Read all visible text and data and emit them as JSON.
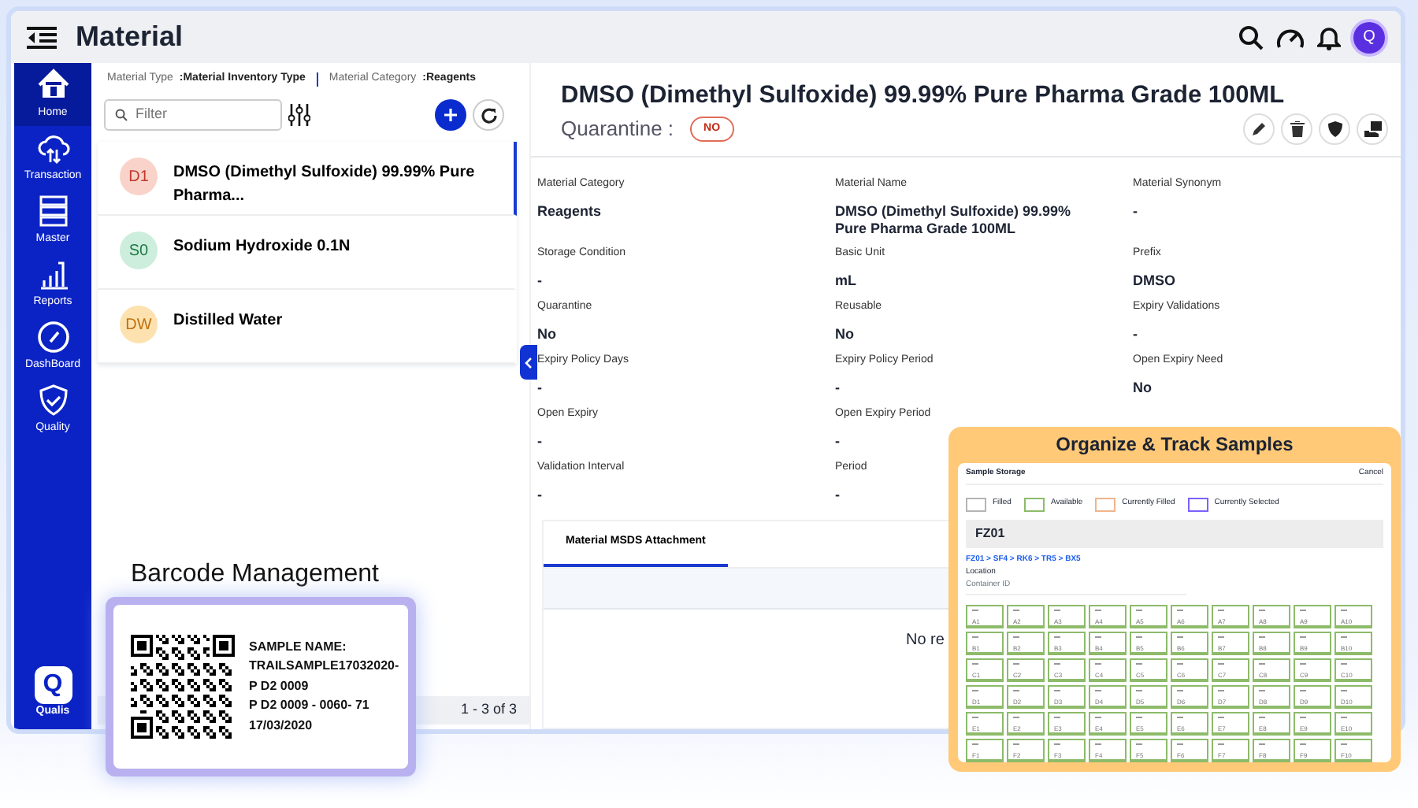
{
  "header": {
    "title": "Material",
    "avatar": "Q"
  },
  "sidebar": {
    "items": [
      {
        "label": "Home",
        "selected": true
      },
      {
        "label": "Transaction",
        "selected": false
      },
      {
        "label": "Master",
        "selected": false
      },
      {
        "label": "Reports",
        "selected": false
      },
      {
        "label": "DashBoard",
        "selected": false
      },
      {
        "label": "Quality",
        "selected": false
      }
    ],
    "logo": "Q",
    "logo_text": "Qualis"
  },
  "breadcrumb": [
    {
      "label": "Material Type",
      "value": ":Material Inventory Type"
    },
    {
      "label": "Material Category",
      "value": ":Reagents"
    }
  ],
  "filter": {
    "placeholder": "Filter"
  },
  "materials": [
    {
      "initials": "D1",
      "name": "DMSO (Dimethyl Sulfoxide) 99.99% Pure Pharma...",
      "color": "#f9d3c9",
      "selected": true
    },
    {
      "initials": "S0",
      "name": "Sodium Hydroxide 0.1N",
      "color": "#cdeedd",
      "selected": false
    },
    {
      "initials": "DW",
      "name": "Distilled Water",
      "color": "#fde2b0",
      "selected": false
    }
  ],
  "pagination": "1 - 3 of 3",
  "detail": {
    "title": "DMSO (Dimethyl Sulfoxide) 99.99% Pure Pharma Grade 100ML",
    "quarantine_label": "Quarantine :",
    "quarantine_badge": "NO",
    "fields": [
      {
        "label": "Material Category",
        "value": "Reagents"
      },
      {
        "label": "Material Name",
        "value": "DMSO (Dimethyl Sulfoxide) 99.99% Pure Pharma Grade 100ML"
      },
      {
        "label": "Material Synonym",
        "value": "-"
      },
      {
        "label": "Storage Condition",
        "value": "-"
      },
      {
        "label": "Basic Unit",
        "value": "mL"
      },
      {
        "label": "Prefix",
        "value": "DMSO"
      },
      {
        "label": "Quarantine",
        "value": "No"
      },
      {
        "label": "Reusable",
        "value": "No"
      },
      {
        "label": "Expiry Validations",
        "value": "-"
      },
      {
        "label": "Expiry Policy Days",
        "value": "-"
      },
      {
        "label": "Expiry Policy Period",
        "value": "-"
      },
      {
        "label": "Open Expiry Need",
        "value": "No"
      },
      {
        "label": "Open Expiry",
        "value": "-"
      },
      {
        "label": "Open Expiry Period",
        "value": "-"
      },
      {
        "label": "Validation Interval",
        "value": "-"
      },
      {
        "label": "Period",
        "value": "-"
      }
    ],
    "tabs": [
      {
        "label": "Material MSDS Attachment",
        "selected": true
      }
    ],
    "empty_text": "No re"
  },
  "barcode": {
    "heading": "Barcode Management",
    "lines": [
      "SAMPLE NAME:",
      "TRAILSAMPLE17032020-",
      "P D2 0009",
      "P D2 0009 - 0060- 71",
      "17/03/2020"
    ]
  },
  "storage": {
    "heading": "Organize & Track Samples",
    "title": "Sample Storage",
    "cancel": "Cancel",
    "legend": [
      {
        "label": "Filled",
        "color": "#b5b5b5"
      },
      {
        "label": "Available",
        "color": "#8dbb6a"
      },
      {
        "label": "Currently Filled",
        "color": "#f0b58c"
      },
      {
        "label": "Currently Selected",
        "color": "#7b61ff"
      }
    ],
    "freezer": "FZ01",
    "path": "FZ01 > SF4 > RK6 > TR5 > BX5",
    "location_label": "Location",
    "location_value": "Container ID",
    "rows": [
      [
        "A1",
        "A2",
        "A3",
        "A4",
        "A5",
        "A6",
        "A7",
        "A8",
        "A9",
        "A10"
      ],
      [
        "B1",
        "B2",
        "B3",
        "B4",
        "B5",
        "B6",
        "B7",
        "B8",
        "B9",
        "B10"
      ],
      [
        "C1",
        "C2",
        "C3",
        "C4",
        "C5",
        "C6",
        "C7",
        "C8",
        "C9",
        "C10"
      ],
      [
        "D1",
        "D2",
        "D3",
        "D4",
        "D5",
        "D6",
        "D7",
        "D8",
        "D9",
        "D10"
      ],
      [
        "E1",
        "E2",
        "E3",
        "E4",
        "E5",
        "E6",
        "E7",
        "E8",
        "E9",
        "E10"
      ],
      [
        "F1",
        "F2",
        "F3",
        "F4",
        "F5",
        "F6",
        "F7",
        "F8",
        "F9",
        "F10"
      ]
    ]
  }
}
